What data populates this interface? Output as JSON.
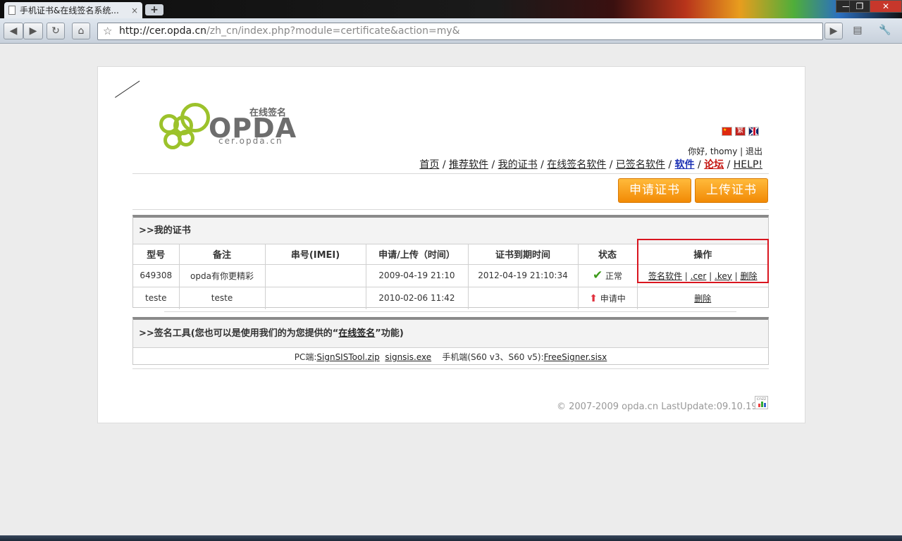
{
  "browser": {
    "tab_title": "手机证书&在线签名系统...",
    "tab_close": "×",
    "new_tab": "+",
    "url_host": "http://cer.opda.cn",
    "url_rest": "/zh_cn/index.php?module=certificate&action=my&",
    "minimize": "—",
    "maximize": "❐",
    "close": "✕",
    "back": "◀",
    "forward": "▶",
    "reload": "↻",
    "home": "⌂",
    "bookmark_star": "☆",
    "go": "▶",
    "page_menu": "▤",
    "wrench_menu": "🔧",
    "colors": {
      "tab": "#e7ebf0",
      "toolbar": "#d3dbe4"
    }
  },
  "site": {
    "logo_sub": "在线签名",
    "logo_brand": "OPDA",
    "logo_url": "cer.opda.cn",
    "flag_tw_text": "繁",
    "greeting": "你好, thomy | ",
    "logout": "退出",
    "nav": [
      {
        "label": "首页",
        "style": "plain"
      },
      {
        "label": "推荐软件",
        "style": "plain"
      },
      {
        "label": "我的证书",
        "style": "plain"
      },
      {
        "label": "在线签名软件",
        "style": "plain"
      },
      {
        "label": "已签名软件",
        "style": "plain"
      },
      {
        "label": "软件",
        "style": "blue"
      },
      {
        "label": "论坛",
        "style": "red"
      },
      {
        "label": "HELP!",
        "style": "plain"
      }
    ],
    "nav_sep": " / ",
    "apply_button": "申请证书",
    "upload_button": "上传证书",
    "my_certs_heading": ">>我的证书",
    "table": {
      "headers": [
        "型号",
        "备注",
        "串号(IMEI)",
        "申请/上传（时间）",
        "证书到期时间",
        "状态",
        "操作"
      ],
      "rows": [
        {
          "model": "649308",
          "note": "opda有你更精彩",
          "imei": "",
          "applied": "2009-04-19 21:10",
          "expires": "2012-04-19 21:10:34",
          "status_icon": "✔",
          "status": "正常",
          "actions": [
            "签名软件",
            ".cer",
            ".key",
            "删除"
          ]
        },
        {
          "model": "teste",
          "note": "teste",
          "imei": "",
          "applied": "2010-02-06 11:42",
          "expires": "",
          "status_icon": "⬆",
          "status": "申请中",
          "actions": [
            "删除"
          ]
        }
      ],
      "action_sep": " | "
    },
    "tools_heading_prefix": ">>签名工具(您也可以是使用我们的为您提供的“",
    "tools_heading_link": "在线签名",
    "tools_heading_suffix": "”功能)",
    "tools_pc_label": "PC端:",
    "tools_pc_links": [
      "SignSISTool.zip",
      "signsis.exe"
    ],
    "tools_mobile_label": "手机端(S60 v3、S60 v5):",
    "tools_mobile_link": "FreeSigner.sisx",
    "footer": "© 2007-2009 opda.cn LastUpdate:09.10.19",
    "cnzz": "cnzz",
    "colors": {
      "accent_orange": "#f28a05",
      "logo_green": "#9cc22b",
      "highlight_red": "#d9151f"
    }
  }
}
